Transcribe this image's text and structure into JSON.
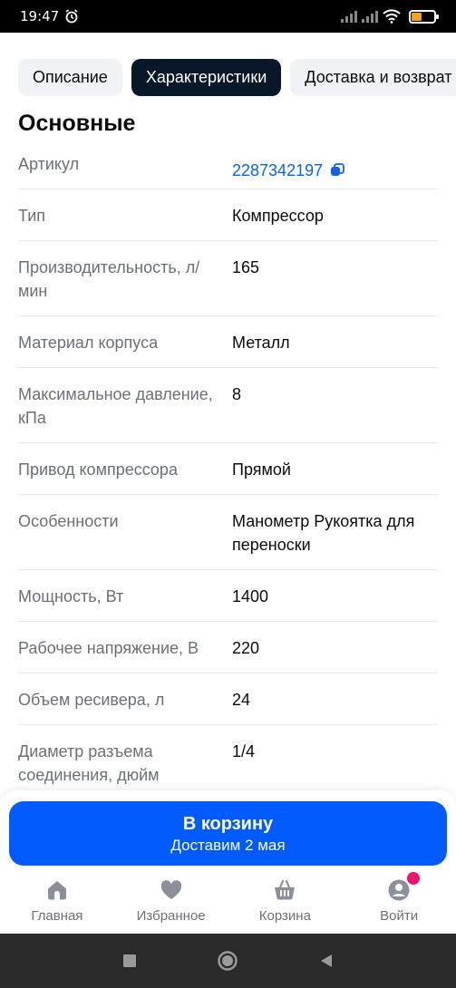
{
  "status": {
    "time": "19:47"
  },
  "tabs": [
    {
      "label": "Описание",
      "active": false
    },
    {
      "label": "Характеристики",
      "active": true
    },
    {
      "label": "Доставка и возврат",
      "active": false
    }
  ],
  "section": {
    "title": "Основные"
  },
  "specs": [
    {
      "key": "Артикул",
      "value": "2287342197"
    },
    {
      "key": "Тип",
      "value": "Компрессор"
    },
    {
      "key": "Производительность, л/мин",
      "value": "165"
    },
    {
      "key": "Материал корпуса",
      "value": "Металл"
    },
    {
      "key": "Максимальное давление, кПа",
      "value": "8"
    },
    {
      "key": "Привод компрессора",
      "value": "Прямой"
    },
    {
      "key": "Особенности",
      "value": "Манометр Рукоятка для переноски"
    },
    {
      "key": "Мощность, Вт",
      "value": "1400"
    },
    {
      "key": "Рабочее напряжение, В",
      "value": "220"
    },
    {
      "key": "Объем ресивера, л",
      "value": "24"
    },
    {
      "key": "Диаметр разъема соединения, дюйм",
      "value": "1/4"
    }
  ],
  "cart": {
    "title": "В корзину",
    "subtitle": "Доставим 2 мая"
  },
  "nav": [
    {
      "label": "Главная",
      "icon": "home-icon"
    },
    {
      "label": "Избранное",
      "icon": "heart-icon"
    },
    {
      "label": "Корзина",
      "icon": "basket-icon"
    },
    {
      "label": "Войти",
      "icon": "user-icon"
    }
  ],
  "colors": {
    "accent": "#005bff",
    "link": "#0a62ea",
    "active_tab": "#08182a",
    "badge": "#f0136b"
  }
}
